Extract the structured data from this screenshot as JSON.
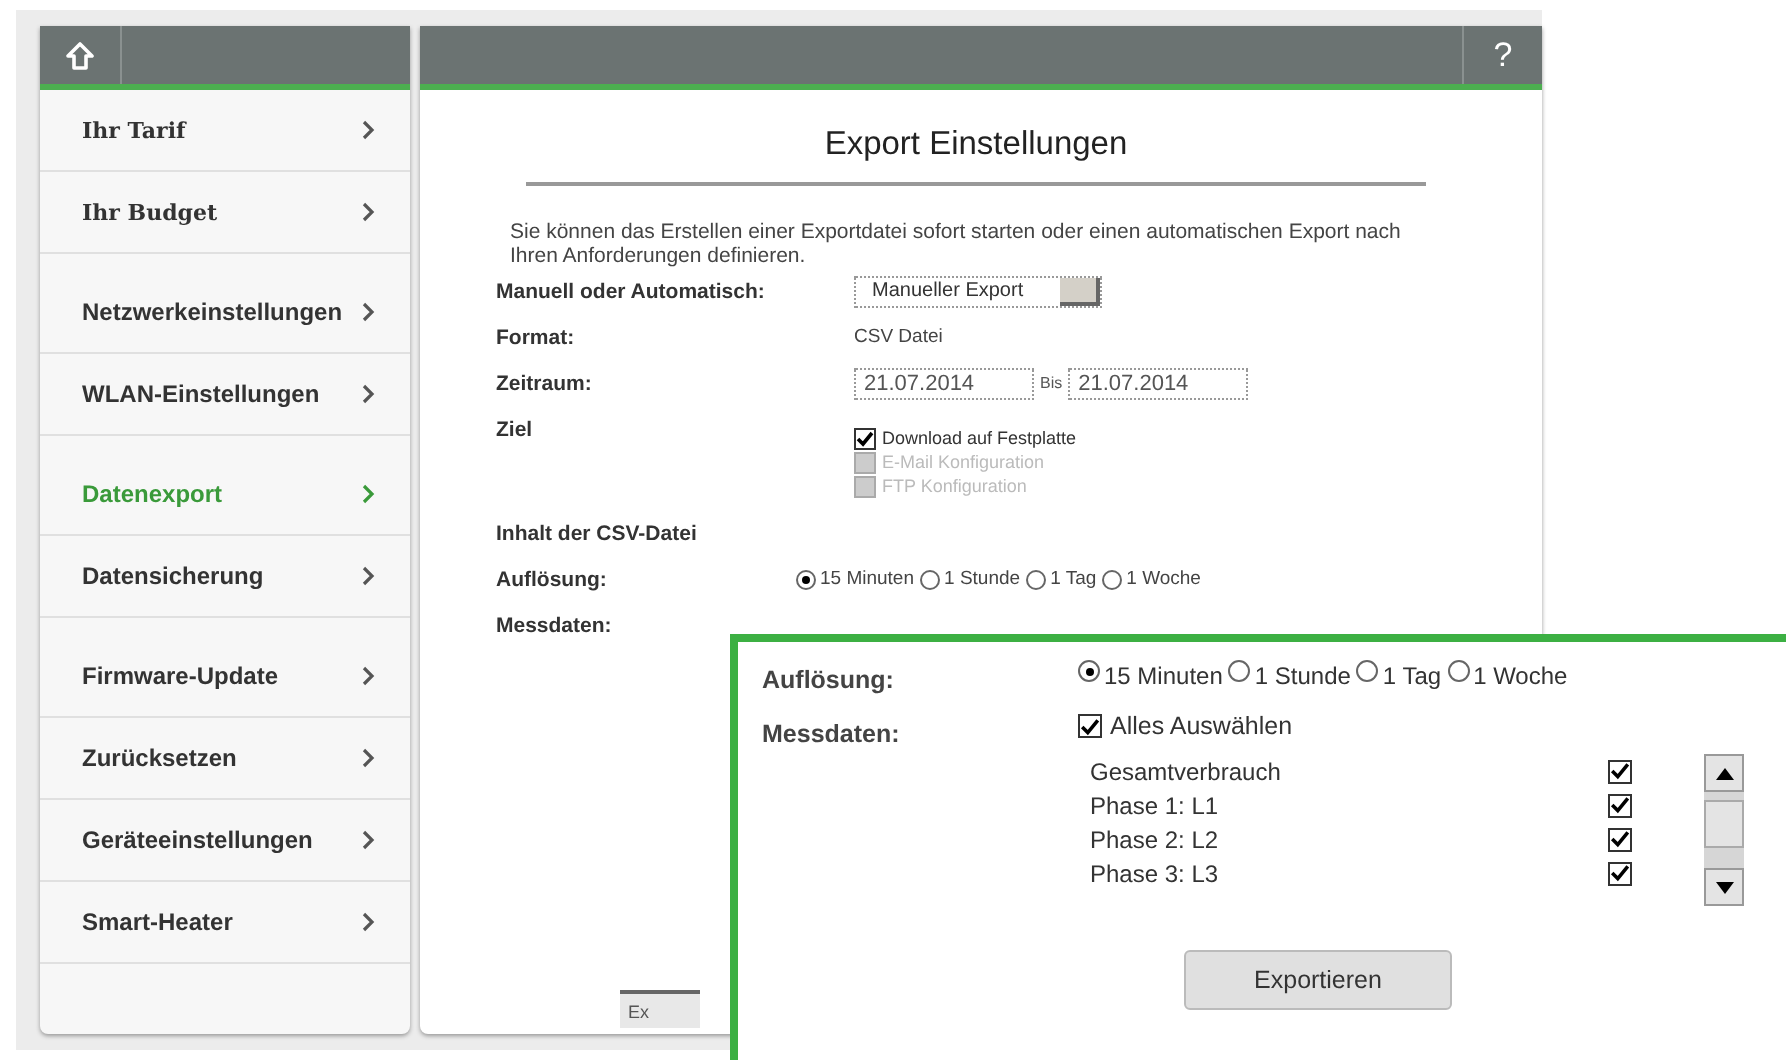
{
  "sidebar": {
    "items": [
      {
        "label": "Ihr Tarif",
        "selected": false
      },
      {
        "label": "Ihr Budget",
        "selected": false
      },
      {
        "label": "Netzwerkeinstellungen",
        "selected": false
      },
      {
        "label": "WLAN-Einstellungen",
        "selected": false
      },
      {
        "label": "Datenexport",
        "selected": true
      },
      {
        "label": "Datensicherung",
        "selected": false
      },
      {
        "label": "Firmware-Update",
        "selected": false
      },
      {
        "label": "Zurücksetzen",
        "selected": false
      },
      {
        "label": "Geräteeinstellungen",
        "selected": false
      },
      {
        "label": "Smart-Heater",
        "selected": false
      }
    ]
  },
  "header": {
    "help": "?"
  },
  "main": {
    "title": "Export Einstellungen",
    "description": "Sie können das Erstellen einer Exportdatei sofort starten oder einen automatischen Export nach Ihren Anforderungen definieren.",
    "mode": {
      "label": "Manuell oder Automatisch:",
      "value": "Manueller Export"
    },
    "format": {
      "label": "Format:",
      "value": "CSV Datei"
    },
    "period": {
      "label": "Zeitraum:",
      "from": "21.07.2014",
      "separator": "Bis",
      "to": "21.07.2014"
    },
    "target": {
      "label": "Ziel",
      "options": [
        {
          "label": "Download auf Festplatte",
          "checked": true,
          "disabled": false
        },
        {
          "label": "E-Mail Konfiguration",
          "checked": false,
          "disabled": true
        },
        {
          "label": "FTP Konfiguration",
          "checked": false,
          "disabled": true
        }
      ]
    },
    "csv_heading": "Inhalt der CSV-Datei",
    "resolution": {
      "label": "Auflösung:",
      "options": [
        {
          "label": "15 Minuten",
          "selected": true
        },
        {
          "label": "1 Stunde",
          "selected": false
        },
        {
          "label": "1 Tag",
          "selected": false
        },
        {
          "label": "1 Woche",
          "selected": false
        }
      ]
    },
    "measurements_label": "Messdaten:",
    "export_button": "Ex"
  },
  "zoom_inset": {
    "resolution": {
      "label": "Auflösung:",
      "options": [
        {
          "label": "15 Minuten",
          "selected": true
        },
        {
          "label": "1 Stunde",
          "selected": false
        },
        {
          "label": "1 Tag",
          "selected": false
        },
        {
          "label": "1 Woche",
          "selected": false
        }
      ]
    },
    "measurements": {
      "label": "Messdaten:",
      "select_all": {
        "label": "Alles Auswählen",
        "checked": true
      },
      "items": [
        {
          "label": "Gesamtverbrauch",
          "checked": true
        },
        {
          "label": "Phase 1: L1",
          "checked": true
        },
        {
          "label": "Phase 2: L2",
          "checked": true
        },
        {
          "label": "Phase 3: L3",
          "checked": true
        }
      ]
    },
    "export_button": "Exportieren"
  }
}
